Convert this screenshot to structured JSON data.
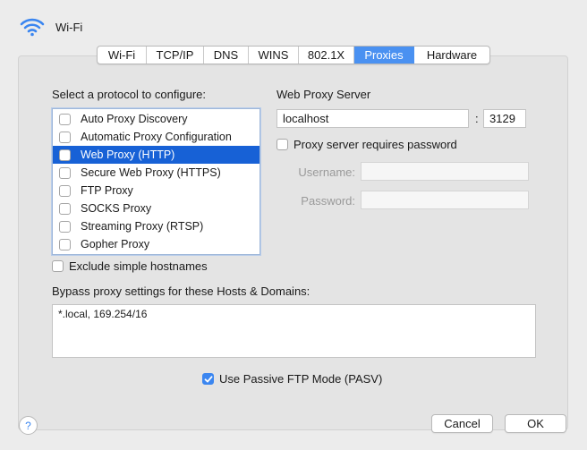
{
  "window": {
    "title": "Wi-Fi",
    "icon": "wifi-icon",
    "accent_color": "#4a91f1",
    "selection_color": "#1761d6"
  },
  "tabs": [
    {
      "label": "Wi-Fi",
      "active": false
    },
    {
      "label": "TCP/IP",
      "active": false
    },
    {
      "label": "DNS",
      "active": false
    },
    {
      "label": "WINS",
      "active": false
    },
    {
      "label": "802.1X",
      "active": false
    },
    {
      "label": "Proxies",
      "active": true
    },
    {
      "label": "Hardware",
      "active": false
    }
  ],
  "proxies": {
    "protocol_heading": "Select a protocol to configure:",
    "protocols": [
      {
        "label": "Auto Proxy Discovery",
        "checked": false,
        "selected": false
      },
      {
        "label": "Automatic Proxy Configuration",
        "checked": false,
        "selected": false
      },
      {
        "label": "Web Proxy (HTTP)",
        "checked": false,
        "selected": true
      },
      {
        "label": "Secure Web Proxy (HTTPS)",
        "checked": false,
        "selected": false
      },
      {
        "label": "FTP Proxy",
        "checked": false,
        "selected": false
      },
      {
        "label": "SOCKS Proxy",
        "checked": false,
        "selected": false
      },
      {
        "label": "Streaming Proxy (RTSP)",
        "checked": false,
        "selected": false
      },
      {
        "label": "Gopher Proxy",
        "checked": false,
        "selected": false
      }
    ],
    "server_heading": "Web Proxy Server",
    "server": "localhost",
    "port_separator": ":",
    "port": "3129",
    "requires_password_label": "Proxy server requires password",
    "requires_password": false,
    "username_label": "Username:",
    "username": "",
    "password_label": "Password:",
    "password": "",
    "exclude_simple_label": "Exclude simple hostnames",
    "exclude_simple": false,
    "bypass_heading": "Bypass proxy settings for these Hosts & Domains:",
    "bypass_value": "*.local, 169.254/16",
    "passive_ftp_label": "Use Passive FTP Mode (PASV)",
    "passive_ftp": true
  },
  "footer": {
    "help_label": "?",
    "cancel_label": "Cancel",
    "ok_label": "OK"
  }
}
